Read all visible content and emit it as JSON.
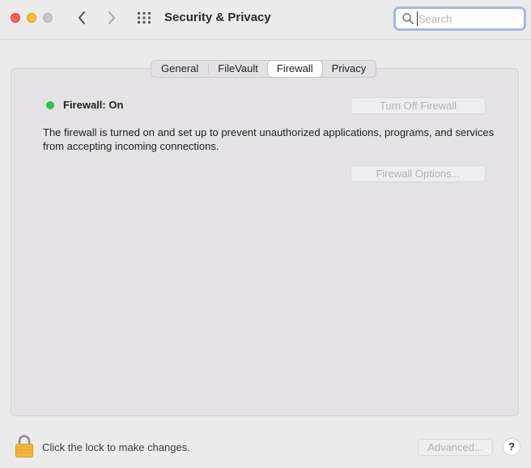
{
  "window": {
    "title": "Security & Privacy",
    "traffic_lights": {
      "close": "#fe5f57",
      "minimize": "#febc2e",
      "zoom": "#c8c6c8"
    }
  },
  "toolbar": {
    "back_icon": "chevron-left-icon",
    "forward_icon": "chevron-right-icon",
    "show_all_icon": "grid-icon"
  },
  "search": {
    "placeholder": "Search",
    "value": ""
  },
  "tabs": [
    {
      "label": "General",
      "active": false
    },
    {
      "label": "FileVault",
      "active": false
    },
    {
      "label": "Firewall",
      "active": true
    },
    {
      "label": "Privacy",
      "active": false
    }
  ],
  "firewall": {
    "status_label": "Firewall: On",
    "status_color": "#28c941",
    "turn_off_label": "Turn Off Firewall",
    "description": "The firewall is turned on and set up to prevent unauthorized applications, programs, and services from accepting incoming connections.",
    "options_label": "Firewall Options..."
  },
  "footer": {
    "lock_text": "Click the lock to make changes.",
    "advanced_label": "Advanced...",
    "help_label": "?"
  }
}
